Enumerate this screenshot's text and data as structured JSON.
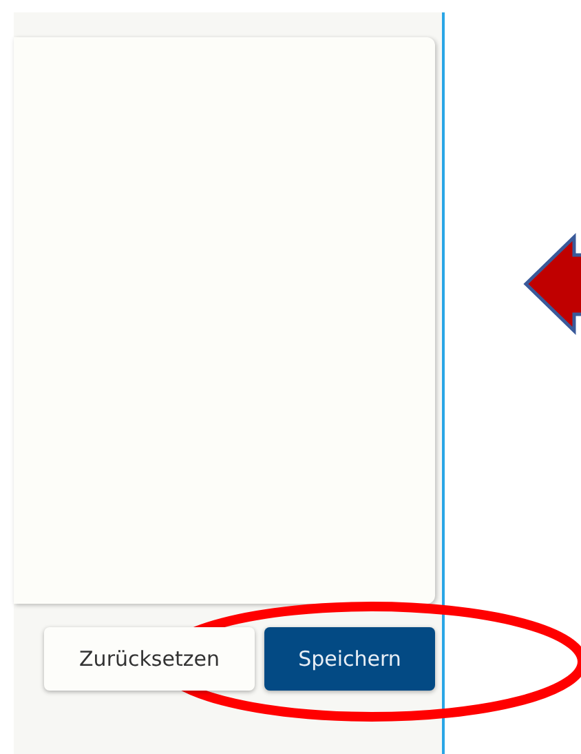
{
  "buttons": [
    {
      "label": "Zurücksetzen",
      "kind": "secondary"
    },
    {
      "label": "Speichern",
      "kind": "primary"
    }
  ]
}
